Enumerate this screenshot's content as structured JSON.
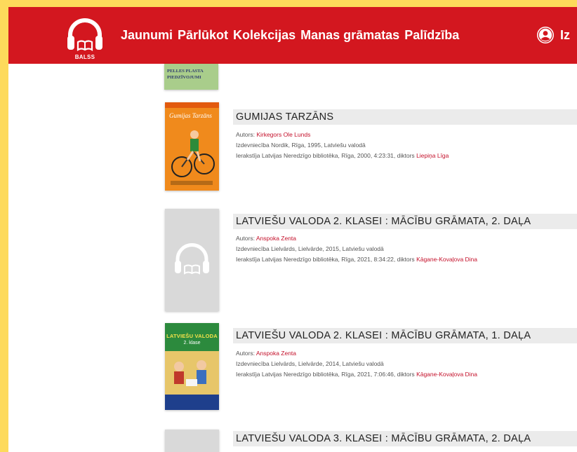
{
  "app": {
    "logo_text": "BALSS",
    "nav": [
      "Jaunumi",
      "Pārlūkot",
      "Kolekcijas",
      "Manas grāmatas",
      "Palīdzība"
    ],
    "user_label": "Iz"
  },
  "colors": {
    "brand_red": "#D3171F",
    "link_red": "#C4102A",
    "page_bg": "#FDDA5B"
  },
  "partial_cover_text": "PELLES PLASTA PIEDZĪVOJUMI",
  "books": [
    {
      "title": "GUMIJAS TARZĀNS",
      "author_label": "Autors:",
      "author": "Kirkegors Ole Lunds",
      "publisher": "Izdevniecība Nordik, Rīga, 1995, Latviešu valodā",
      "recording": "Ierakstīja Latvijas Neredzīgo bibliotēka, Rīga, 2000, 4:23:31, diktors",
      "narrator": "Liepiņa Līga",
      "cover": "illustrated-tarzans",
      "cover_text": "Gumijas Tarzāns"
    },
    {
      "title": "LATVIEŠU VALODA 2. KLASEI : MĀCĪBU GRĀMATA, 2. DAĻA",
      "author_label": "Autors:",
      "author": "Anspoka Zenta",
      "publisher": "Izdevniecība Lielvārds, Lielvārde, 2015, Latviešu valodā",
      "recording": "Ierakstīja Latvijas Neredzīgo bibliotēka, Rīga, 2021, 8:34:22, diktors",
      "narrator": "Kāgane-Kovaļova Dina",
      "cover": "placeholder-headphones"
    },
    {
      "title": "LATVIEŠU VALODA 2. KLASEI : MĀCĪBU GRĀMATA, 1. DAĻA",
      "author_label": "Autors:",
      "author": "Anspoka Zenta",
      "publisher": "Izdevniecība Lielvārds, Lielvārde, 2014, Latviešu valodā",
      "recording": "Ierakstīja Latvijas Neredzīgo bibliotēka, Rīga, 2021, 7:06:46, diktors",
      "narrator": "Kāgane-Kovaļova Dina",
      "cover": "illustrated-latviesu-valoda",
      "cover_text": "LATVIEŠU VALODA",
      "cover_sub": "2. klase"
    },
    {
      "title": "LATVIEŠU VALODA 3. KLASEI : MĀCĪBU GRĀMATA, 2. DAĻA",
      "cover": "placeholder-headphones"
    }
  ]
}
